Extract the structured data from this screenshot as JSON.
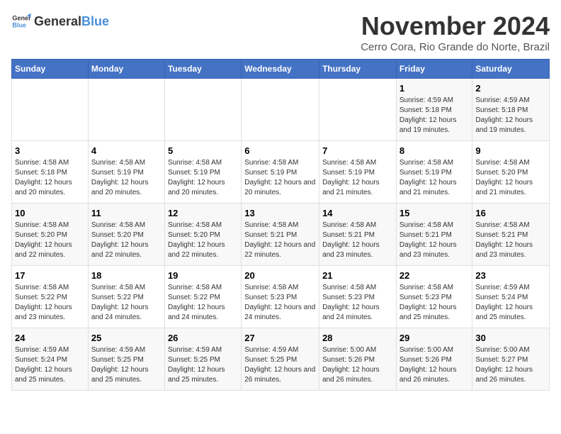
{
  "logo": {
    "general": "General",
    "blue": "Blue"
  },
  "title": "November 2024",
  "subtitle": "Cerro Cora, Rio Grande do Norte, Brazil",
  "days_header": [
    "Sunday",
    "Monday",
    "Tuesday",
    "Wednesday",
    "Thursday",
    "Friday",
    "Saturday"
  ],
  "weeks": [
    [
      {
        "day": "",
        "info": ""
      },
      {
        "day": "",
        "info": ""
      },
      {
        "day": "",
        "info": ""
      },
      {
        "day": "",
        "info": ""
      },
      {
        "day": "",
        "info": ""
      },
      {
        "day": "1",
        "info": "Sunrise: 4:59 AM\nSunset: 5:18 PM\nDaylight: 12 hours and 19 minutes."
      },
      {
        "day": "2",
        "info": "Sunrise: 4:59 AM\nSunset: 5:18 PM\nDaylight: 12 hours and 19 minutes."
      }
    ],
    [
      {
        "day": "3",
        "info": "Sunrise: 4:58 AM\nSunset: 5:18 PM\nDaylight: 12 hours and 20 minutes."
      },
      {
        "day": "4",
        "info": "Sunrise: 4:58 AM\nSunset: 5:19 PM\nDaylight: 12 hours and 20 minutes."
      },
      {
        "day": "5",
        "info": "Sunrise: 4:58 AM\nSunset: 5:19 PM\nDaylight: 12 hours and 20 minutes."
      },
      {
        "day": "6",
        "info": "Sunrise: 4:58 AM\nSunset: 5:19 PM\nDaylight: 12 hours and 20 minutes."
      },
      {
        "day": "7",
        "info": "Sunrise: 4:58 AM\nSunset: 5:19 PM\nDaylight: 12 hours and 21 minutes."
      },
      {
        "day": "8",
        "info": "Sunrise: 4:58 AM\nSunset: 5:19 PM\nDaylight: 12 hours and 21 minutes."
      },
      {
        "day": "9",
        "info": "Sunrise: 4:58 AM\nSunset: 5:20 PM\nDaylight: 12 hours and 21 minutes."
      }
    ],
    [
      {
        "day": "10",
        "info": "Sunrise: 4:58 AM\nSunset: 5:20 PM\nDaylight: 12 hours and 22 minutes."
      },
      {
        "day": "11",
        "info": "Sunrise: 4:58 AM\nSunset: 5:20 PM\nDaylight: 12 hours and 22 minutes."
      },
      {
        "day": "12",
        "info": "Sunrise: 4:58 AM\nSunset: 5:20 PM\nDaylight: 12 hours and 22 minutes."
      },
      {
        "day": "13",
        "info": "Sunrise: 4:58 AM\nSunset: 5:21 PM\nDaylight: 12 hours and 22 minutes."
      },
      {
        "day": "14",
        "info": "Sunrise: 4:58 AM\nSunset: 5:21 PM\nDaylight: 12 hours and 23 minutes."
      },
      {
        "day": "15",
        "info": "Sunrise: 4:58 AM\nSunset: 5:21 PM\nDaylight: 12 hours and 23 minutes."
      },
      {
        "day": "16",
        "info": "Sunrise: 4:58 AM\nSunset: 5:21 PM\nDaylight: 12 hours and 23 minutes."
      }
    ],
    [
      {
        "day": "17",
        "info": "Sunrise: 4:58 AM\nSunset: 5:22 PM\nDaylight: 12 hours and 23 minutes."
      },
      {
        "day": "18",
        "info": "Sunrise: 4:58 AM\nSunset: 5:22 PM\nDaylight: 12 hours and 24 minutes."
      },
      {
        "day": "19",
        "info": "Sunrise: 4:58 AM\nSunset: 5:22 PM\nDaylight: 12 hours and 24 minutes."
      },
      {
        "day": "20",
        "info": "Sunrise: 4:58 AM\nSunset: 5:23 PM\nDaylight: 12 hours and 24 minutes."
      },
      {
        "day": "21",
        "info": "Sunrise: 4:58 AM\nSunset: 5:23 PM\nDaylight: 12 hours and 24 minutes."
      },
      {
        "day": "22",
        "info": "Sunrise: 4:58 AM\nSunset: 5:23 PM\nDaylight: 12 hours and 25 minutes."
      },
      {
        "day": "23",
        "info": "Sunrise: 4:59 AM\nSunset: 5:24 PM\nDaylight: 12 hours and 25 minutes."
      }
    ],
    [
      {
        "day": "24",
        "info": "Sunrise: 4:59 AM\nSunset: 5:24 PM\nDaylight: 12 hours and 25 minutes."
      },
      {
        "day": "25",
        "info": "Sunrise: 4:59 AM\nSunset: 5:25 PM\nDaylight: 12 hours and 25 minutes."
      },
      {
        "day": "26",
        "info": "Sunrise: 4:59 AM\nSunset: 5:25 PM\nDaylight: 12 hours and 25 minutes."
      },
      {
        "day": "27",
        "info": "Sunrise: 4:59 AM\nSunset: 5:25 PM\nDaylight: 12 hours and 26 minutes."
      },
      {
        "day": "28",
        "info": "Sunrise: 5:00 AM\nSunset: 5:26 PM\nDaylight: 12 hours and 26 minutes."
      },
      {
        "day": "29",
        "info": "Sunrise: 5:00 AM\nSunset: 5:26 PM\nDaylight: 12 hours and 26 minutes."
      },
      {
        "day": "30",
        "info": "Sunrise: 5:00 AM\nSunset: 5:27 PM\nDaylight: 12 hours and 26 minutes."
      }
    ]
  ]
}
